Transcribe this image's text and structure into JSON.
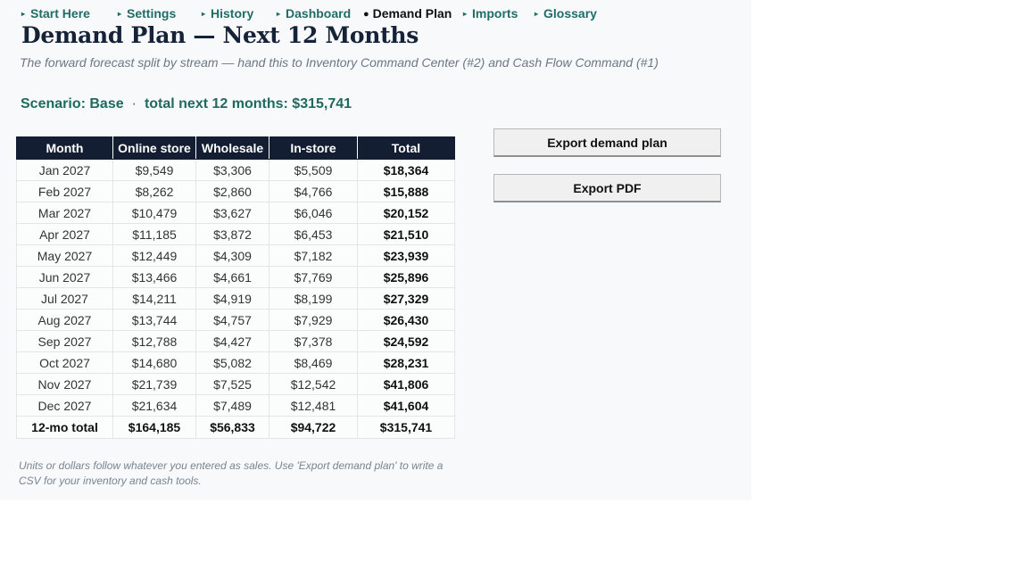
{
  "nav": [
    {
      "label": "Start Here",
      "marker": "▸",
      "active": false
    },
    {
      "label": "Settings",
      "marker": "▸",
      "active": false
    },
    {
      "label": "History",
      "marker": "▸",
      "active": false
    },
    {
      "label": "Dashboard",
      "marker": "▸",
      "active": false
    },
    {
      "label": "Demand Plan",
      "marker": "●",
      "active": true
    },
    {
      "label": "Imports",
      "marker": "▸",
      "active": false
    },
    {
      "label": "Glossary",
      "marker": "▸",
      "active": false
    }
  ],
  "title": "Demand Plan — Next 12 Months",
  "subtitle": "The forward forecast split by stream — hand this to Inventory Command Center (#2) and Cash Flow Command (#1)",
  "scenario": {
    "label": "Scenario: Base",
    "separator": "·",
    "total_text": "total next 12 months: $315,741"
  },
  "table": {
    "headers": [
      "Month",
      "Online store",
      "Wholesale",
      "In-store",
      "Total"
    ],
    "rows": [
      [
        "Jan 2027",
        "$9,549",
        "$3,306",
        "$5,509",
        "$18,364"
      ],
      [
        "Feb 2027",
        "$8,262",
        "$2,860",
        "$4,766",
        "$15,888"
      ],
      [
        "Mar 2027",
        "$10,479",
        "$3,627",
        "$6,046",
        "$20,152"
      ],
      [
        "Apr 2027",
        "$11,185",
        "$3,872",
        "$6,453",
        "$21,510"
      ],
      [
        "May 2027",
        "$12,449",
        "$4,309",
        "$7,182",
        "$23,939"
      ],
      [
        "Jun 2027",
        "$13,466",
        "$4,661",
        "$7,769",
        "$25,896"
      ],
      [
        "Jul 2027",
        "$14,211",
        "$4,919",
        "$8,199",
        "$27,329"
      ],
      [
        "Aug 2027",
        "$13,744",
        "$4,757",
        "$7,929",
        "$26,430"
      ],
      [
        "Sep 2027",
        "$12,788",
        "$4,427",
        "$7,378",
        "$24,592"
      ],
      [
        "Oct 2027",
        "$14,680",
        "$5,082",
        "$8,469",
        "$28,231"
      ],
      [
        "Nov 2027",
        "$21,739",
        "$7,525",
        "$12,542",
        "$41,806"
      ],
      [
        "Dec 2027",
        "$21,634",
        "$7,489",
        "$12,481",
        "$41,604"
      ]
    ],
    "total_row": [
      "12-mo total",
      "$164,185",
      "$56,833",
      "$94,722",
      "$315,741"
    ]
  },
  "buttons": {
    "export_demand": "Export demand plan",
    "export_pdf": "Export PDF"
  },
  "note": "Units or dollars follow whatever you entered as sales. Use 'Export demand plan' to write a CSV for your inventory and cash tools.",
  "colors": {
    "nav_link": "#1f6d66",
    "header_bg": "#131e33",
    "scenario": "#1f6a5e"
  }
}
